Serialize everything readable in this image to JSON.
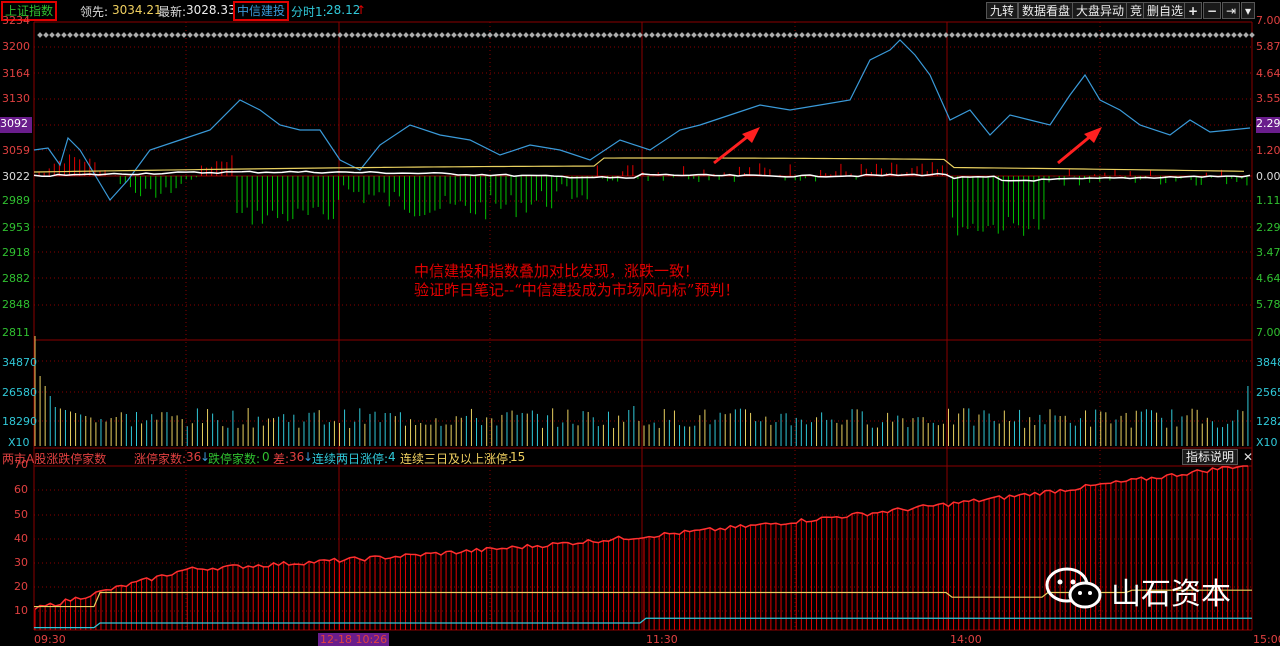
{
  "topbar": {
    "index_label": "上证指数",
    "prev_label": "领先:",
    "prev_value": "3034.21",
    "latest_label": "最新:",
    "latest_value": "3028.33",
    "stock_label": "中信建投",
    "fenshi_label": "分时1:",
    "fenshi_value": "28.12",
    "fenshi_arrow": "↑",
    "buttons": [
      "九转",
      "数据看盘",
      "大盘异动",
      "竞",
      "删自选",
      "+",
      "−",
      "⇥",
      "▾"
    ]
  },
  "price_axis": {
    "left": [
      "3234",
      "3200",
      "3164",
      "3130",
      "3092",
      "3059",
      "3022",
      "2989",
      "2953",
      "2918",
      "2882",
      "2848",
      "2811"
    ],
    "right": [
      "7.00",
      "5.87",
      "4.64",
      "3.55",
      "2.29",
      "1.20",
      "0.00",
      "1.11",
      "2.29",
      "3.47",
      "4.64",
      "5.78",
      "7.00"
    ],
    "highlight_left": "3092",
    "highlight_right": "2.29"
  },
  "volume_axis": {
    "left": [
      "34870",
      "26580",
      "18290",
      "X10"
    ],
    "right": [
      "38481",
      "25654",
      "12827",
      "X10"
    ]
  },
  "annotation": {
    "line1": "中信建投和指数叠加对比发现，涨跌一致！",
    "line2": "验证昨日笔记--“中信建投成为市场风向标”预判！"
  },
  "indicator_header": {
    "name": "两市A股涨跌停家数",
    "up_label": "涨停家数:",
    "up_value": "36",
    "down_label": "跌停家数:",
    "down_value": "0",
    "diff_label": "差:",
    "diff_value": "36",
    "two_day_label": "连续两日涨停:",
    "two_day_value": "4",
    "three_day_label": "连续三日及以上涨停:",
    "three_day_value": "15",
    "help_button": "指标说明",
    "close_icon": "✕"
  },
  "indicator_axis": [
    "70",
    "60",
    "50",
    "40",
    "30",
    "20",
    "10"
  ],
  "time_axis": {
    "labels": [
      "09:30",
      "11:30",
      "14:00",
      "15:00"
    ],
    "cursor_label": "12-18 10:26"
  },
  "watermark": {
    "text": "山石资本",
    "icon": "wechat-icon"
  },
  "colors": {
    "up": "#e00000",
    "down": "#00c000",
    "index_line": "#ffffff",
    "stock_line": "#3a9ad9",
    "avg_line": "#e8d060",
    "grid": "#8a0000",
    "highlight": "#6a1d8c",
    "cyan": "#30c8d8"
  }
}
